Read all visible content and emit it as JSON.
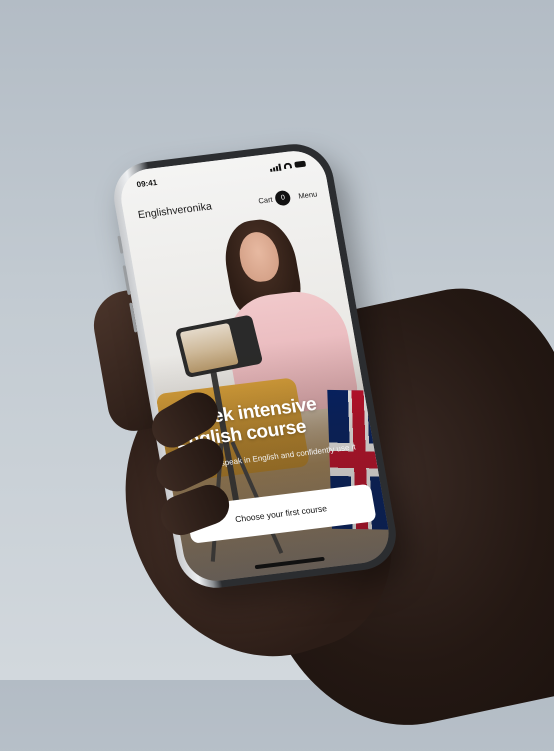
{
  "status_bar": {
    "time": "09:41"
  },
  "nav": {
    "brand": "Englishveronika",
    "cart_label": "Cart",
    "cart_count": "0",
    "menu_label": "Menu"
  },
  "hero": {
    "headline_line1": "8-week intensive",
    "headline_line2": "English course",
    "subtitle": "We help to speak in English and confidently use it in life",
    "cta_label": "Choose your first course"
  },
  "icons": [
    "signal-icon",
    "wifi-icon",
    "battery-icon"
  ],
  "colors": {
    "cta_bg": "#ffffff",
    "badge_bg": "#111111",
    "background": "#c3cbd2"
  }
}
